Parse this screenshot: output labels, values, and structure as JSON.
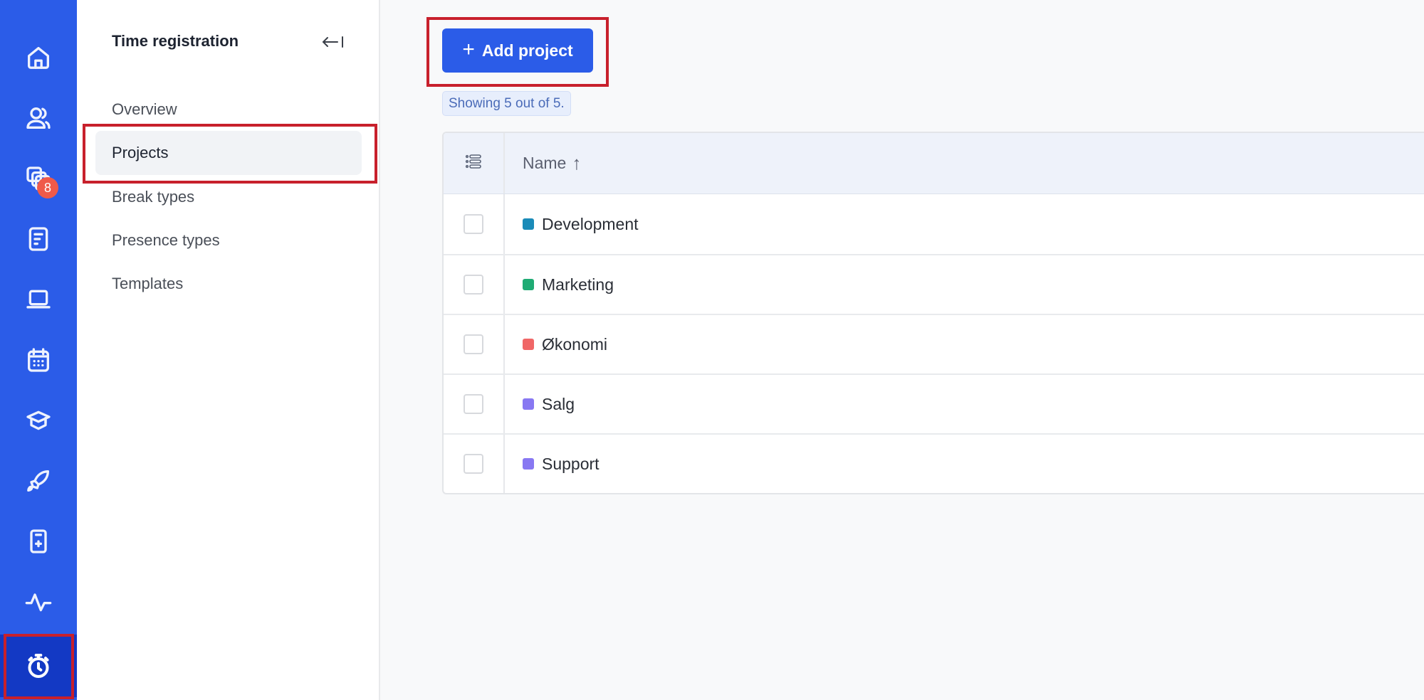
{
  "rail": {
    "items": [
      {
        "icon": "home-icon",
        "label": "Home"
      },
      {
        "icon": "users-icon",
        "label": "People"
      },
      {
        "icon": "documents-stack-icon",
        "label": "Documents",
        "badge": "8"
      },
      {
        "icon": "report-icon",
        "label": "Reports"
      },
      {
        "icon": "laptop-icon",
        "label": "Devices"
      },
      {
        "icon": "calendar-icon",
        "label": "Calendar"
      },
      {
        "icon": "graduation-cap-icon",
        "label": "Learning"
      },
      {
        "icon": "rocket-icon",
        "label": "Onboarding"
      },
      {
        "icon": "phone-plus-icon",
        "label": "Mobile"
      },
      {
        "icon": "activity-icon",
        "label": "Activity"
      },
      {
        "icon": "stopwatch-icon",
        "label": "Time registration",
        "active": true
      }
    ],
    "badge_color": "#ef5a4a",
    "background": "#2b5ce8"
  },
  "subnav": {
    "title": "Time registration",
    "collapse_icon": "collapse-left-icon",
    "items": [
      {
        "label": "Overview"
      },
      {
        "label": "Projects",
        "active": true
      },
      {
        "label": "Break types"
      },
      {
        "label": "Presence types"
      },
      {
        "label": "Templates"
      }
    ]
  },
  "main": {
    "add_button": {
      "icon": "+",
      "label": "Add project"
    },
    "count_text": "Showing 5 out of 5.",
    "table": {
      "columns_icon": "column-settings-icon",
      "header": {
        "name": "Name",
        "sort": "↑"
      },
      "rows": [
        {
          "name": "Development",
          "color": "#1a8bb8"
        },
        {
          "name": "Marketing",
          "color": "#1fab74"
        },
        {
          "name": "Økonomi",
          "color": "#f06767"
        },
        {
          "name": "Salg",
          "color": "#8878f2"
        },
        {
          "name": "Support",
          "color": "#8878f2"
        }
      ]
    }
  }
}
